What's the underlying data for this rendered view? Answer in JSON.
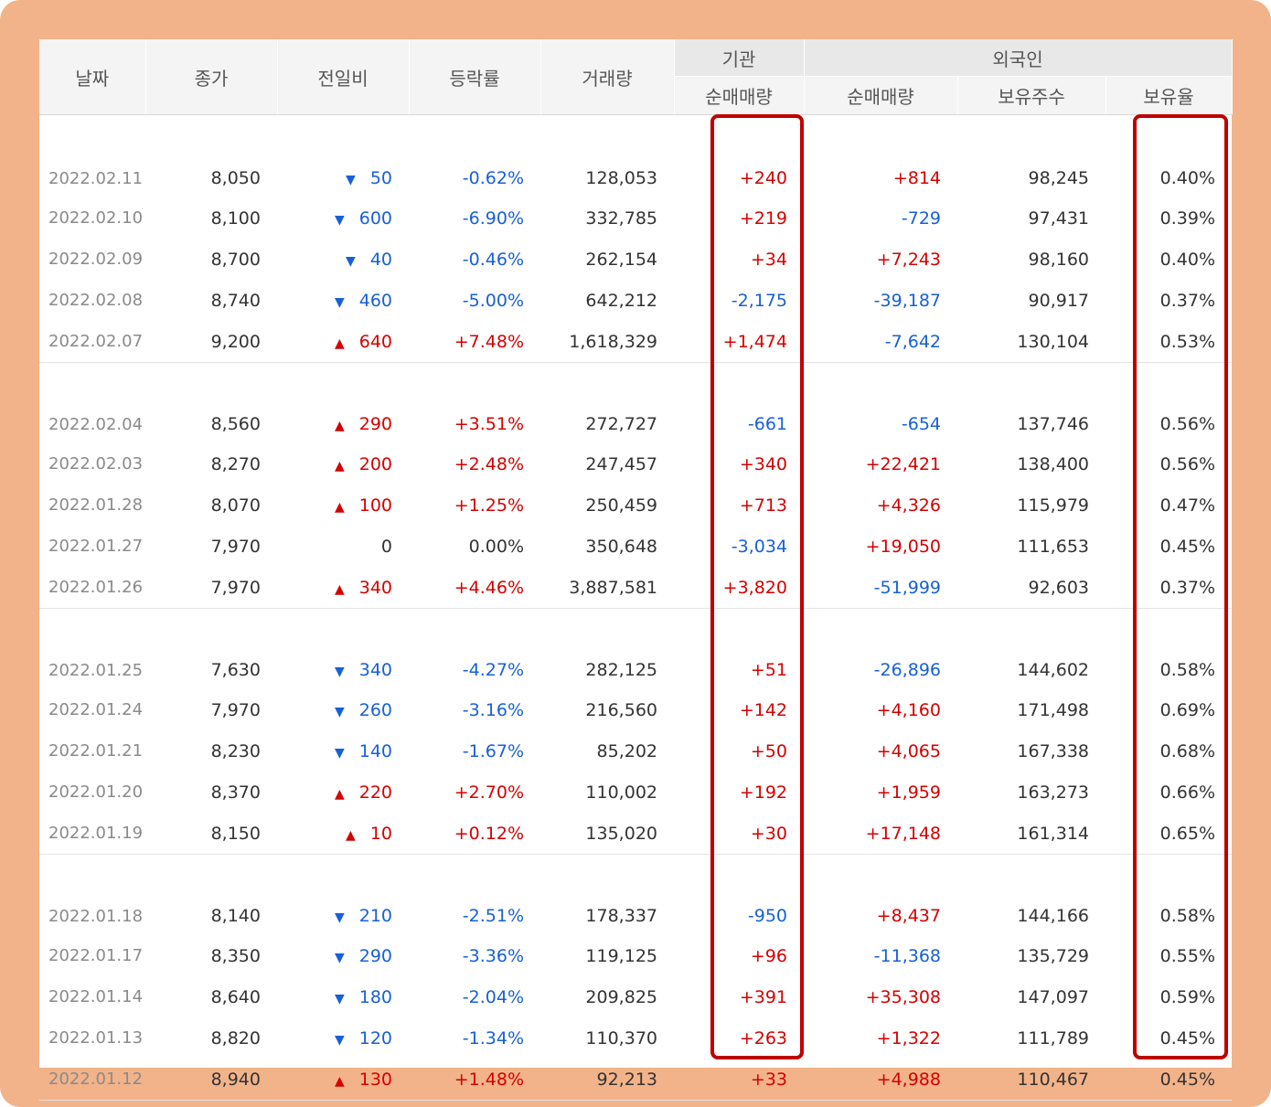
{
  "header": {
    "date": "날짜",
    "close": "종가",
    "change": "전일비",
    "rate": "등락률",
    "volume": "거래량",
    "institution": "기관",
    "institution_net": "순매매량",
    "foreign": "외국인",
    "foreign_net": "순매매량",
    "foreign_holdings": "보유주수",
    "foreign_ratio": "보유율"
  },
  "colors": {
    "up": "#d60000",
    "down": "#1760d8",
    "highlight": "#c00000",
    "frame": "#f2b38a"
  },
  "groups": [
    [
      {
        "date": "2022.02.11",
        "close": "8,050",
        "dir": "down",
        "change": "50",
        "rate": "-0.62%",
        "volume": "128,053",
        "inst": "+240",
        "foreign": "+814",
        "holdings": "98,245",
        "ratio": "0.40%"
      },
      {
        "date": "2022.02.10",
        "close": "8,100",
        "dir": "down",
        "change": "600",
        "rate": "-6.90%",
        "volume": "332,785",
        "inst": "+219",
        "foreign": "-729",
        "holdings": "97,431",
        "ratio": "0.39%"
      },
      {
        "date": "2022.02.09",
        "close": "8,700",
        "dir": "down",
        "change": "40",
        "rate": "-0.46%",
        "volume": "262,154",
        "inst": "+34",
        "foreign": "+7,243",
        "holdings": "98,160",
        "ratio": "0.40%"
      },
      {
        "date": "2022.02.08",
        "close": "8,740",
        "dir": "down",
        "change": "460",
        "rate": "-5.00%",
        "volume": "642,212",
        "inst": "-2,175",
        "foreign": "-39,187",
        "holdings": "90,917",
        "ratio": "0.37%"
      },
      {
        "date": "2022.02.07",
        "close": "9,200",
        "dir": "up",
        "change": "640",
        "rate": "+7.48%",
        "volume": "1,618,329",
        "inst": "+1,474",
        "foreign": "-7,642",
        "holdings": "130,104",
        "ratio": "0.53%"
      }
    ],
    [
      {
        "date": "2022.02.04",
        "close": "8,560",
        "dir": "up",
        "change": "290",
        "rate": "+3.51%",
        "volume": "272,727",
        "inst": "-661",
        "foreign": "-654",
        "holdings": "137,746",
        "ratio": "0.56%"
      },
      {
        "date": "2022.02.03",
        "close": "8,270",
        "dir": "up",
        "change": "200",
        "rate": "+2.48%",
        "volume": "247,457",
        "inst": "+340",
        "foreign": "+22,421",
        "holdings": "138,400",
        "ratio": "0.56%"
      },
      {
        "date": "2022.01.28",
        "close": "8,070",
        "dir": "up",
        "change": "100",
        "rate": "+1.25%",
        "volume": "250,459",
        "inst": "+713",
        "foreign": "+4,326",
        "holdings": "115,979",
        "ratio": "0.47%"
      },
      {
        "date": "2022.01.27",
        "close": "7,970",
        "dir": "none",
        "change": "0",
        "rate": "0.00%",
        "volume": "350,648",
        "inst": "-3,034",
        "foreign": "+19,050",
        "holdings": "111,653",
        "ratio": "0.45%"
      },
      {
        "date": "2022.01.26",
        "close": "7,970",
        "dir": "up",
        "change": "340",
        "rate": "+4.46%",
        "volume": "3,887,581",
        "inst": "+3,820",
        "foreign": "-51,999",
        "holdings": "92,603",
        "ratio": "0.37%"
      }
    ],
    [
      {
        "date": "2022.01.25",
        "close": "7,630",
        "dir": "down",
        "change": "340",
        "rate": "-4.27%",
        "volume": "282,125",
        "inst": "+51",
        "foreign": "-26,896",
        "holdings": "144,602",
        "ratio": "0.58%"
      },
      {
        "date": "2022.01.24",
        "close": "7,970",
        "dir": "down",
        "change": "260",
        "rate": "-3.16%",
        "volume": "216,560",
        "inst": "+142",
        "foreign": "+4,160",
        "holdings": "171,498",
        "ratio": "0.69%"
      },
      {
        "date": "2022.01.21",
        "close": "8,230",
        "dir": "down",
        "change": "140",
        "rate": "-1.67%",
        "volume": "85,202",
        "inst": "+50",
        "foreign": "+4,065",
        "holdings": "167,338",
        "ratio": "0.68%"
      },
      {
        "date": "2022.01.20",
        "close": "8,370",
        "dir": "up",
        "change": "220",
        "rate": "+2.70%",
        "volume": "110,002",
        "inst": "+192",
        "foreign": "+1,959",
        "holdings": "163,273",
        "ratio": "0.66%"
      },
      {
        "date": "2022.01.19",
        "close": "8,150",
        "dir": "up",
        "change": "10",
        "rate": "+0.12%",
        "volume": "135,020",
        "inst": "+30",
        "foreign": "+17,148",
        "holdings": "161,314",
        "ratio": "0.65%"
      }
    ],
    [
      {
        "date": "2022.01.18",
        "close": "8,140",
        "dir": "down",
        "change": "210",
        "rate": "-2.51%",
        "volume": "178,337",
        "inst": "-950",
        "foreign": "+8,437",
        "holdings": "144,166",
        "ratio": "0.58%"
      },
      {
        "date": "2022.01.17",
        "close": "8,350",
        "dir": "down",
        "change": "290",
        "rate": "-3.36%",
        "volume": "119,125",
        "inst": "+96",
        "foreign": "-11,368",
        "holdings": "135,729",
        "ratio": "0.55%"
      },
      {
        "date": "2022.01.14",
        "close": "8,640",
        "dir": "down",
        "change": "180",
        "rate": "-2.04%",
        "volume": "209,825",
        "inst": "+391",
        "foreign": "+35,308",
        "holdings": "147,097",
        "ratio": "0.59%"
      },
      {
        "date": "2022.01.13",
        "close": "8,820",
        "dir": "down",
        "change": "120",
        "rate": "-1.34%",
        "volume": "110,370",
        "inst": "+263",
        "foreign": "+1,322",
        "holdings": "111,789",
        "ratio": "0.45%"
      },
      {
        "date": "2022.01.12",
        "close": "8,940",
        "dir": "up",
        "change": "130",
        "rate": "+1.48%",
        "volume": "92,213",
        "inst": "+33",
        "foreign": "+4,988",
        "holdings": "110,467",
        "ratio": "0.45%"
      }
    ]
  ]
}
